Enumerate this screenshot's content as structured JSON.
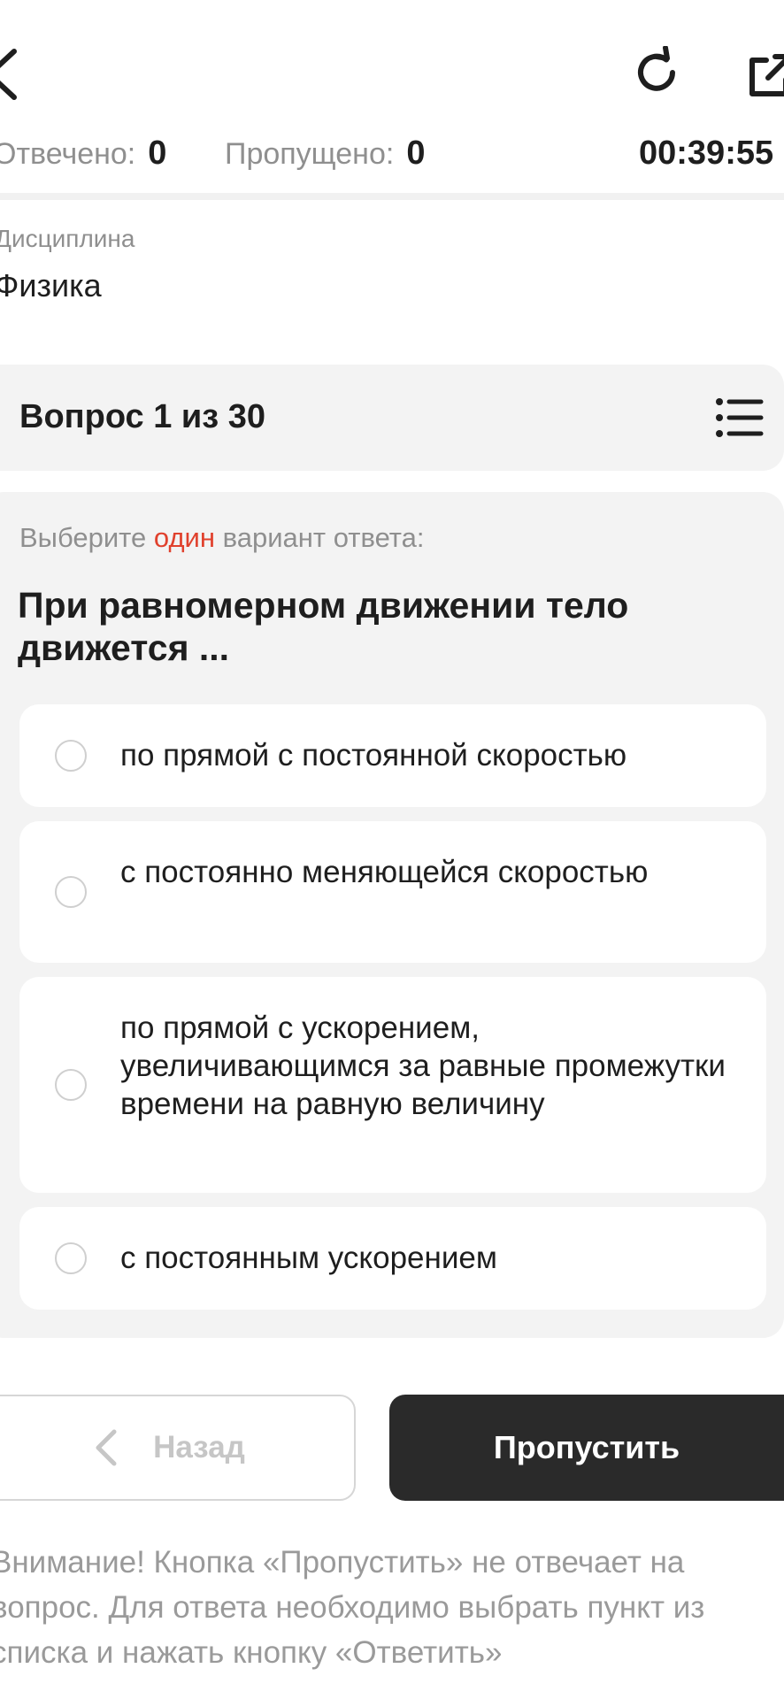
{
  "stats": {
    "answered_label": "Отвечено:",
    "answered_value": "0",
    "skipped_label": "Пропущено:",
    "skipped_value": "0",
    "timer": "00:39:55"
  },
  "discipline": {
    "label": "Дисциплина",
    "value": "Физика"
  },
  "question": {
    "header": "Вопрос 1 из 30",
    "instruction_prefix": "Выберите",
    "instruction_accent": "один",
    "instruction_suffix": "вариант ответа:",
    "text": "При равномерном движении тело движется ...",
    "options": [
      "по прямой с постоянной скоростью",
      "с постоянно меняющейся скоростью",
      "по прямой с ускорением, увеличивающимся за равные промежутки времени на равную величину",
      "с постоянным ускорением"
    ]
  },
  "buttons": {
    "back_label": "Назад",
    "skip_label": "Пропустить"
  },
  "notice": "Внимание! Кнопка «Пропустить» не отвечает на вопрос. Для ответа необходимо выбрать пункт из списка и нажать кнопку «Ответить»",
  "colors": {
    "accent": "#e0412d",
    "primary_button": "#2a2a2a",
    "panel_bg": "#f3f3f3"
  },
  "icons": {
    "back": "chevron-left-icon",
    "refresh": "refresh-icon",
    "open_external": "external-link-icon",
    "question_list": "list-icon"
  }
}
